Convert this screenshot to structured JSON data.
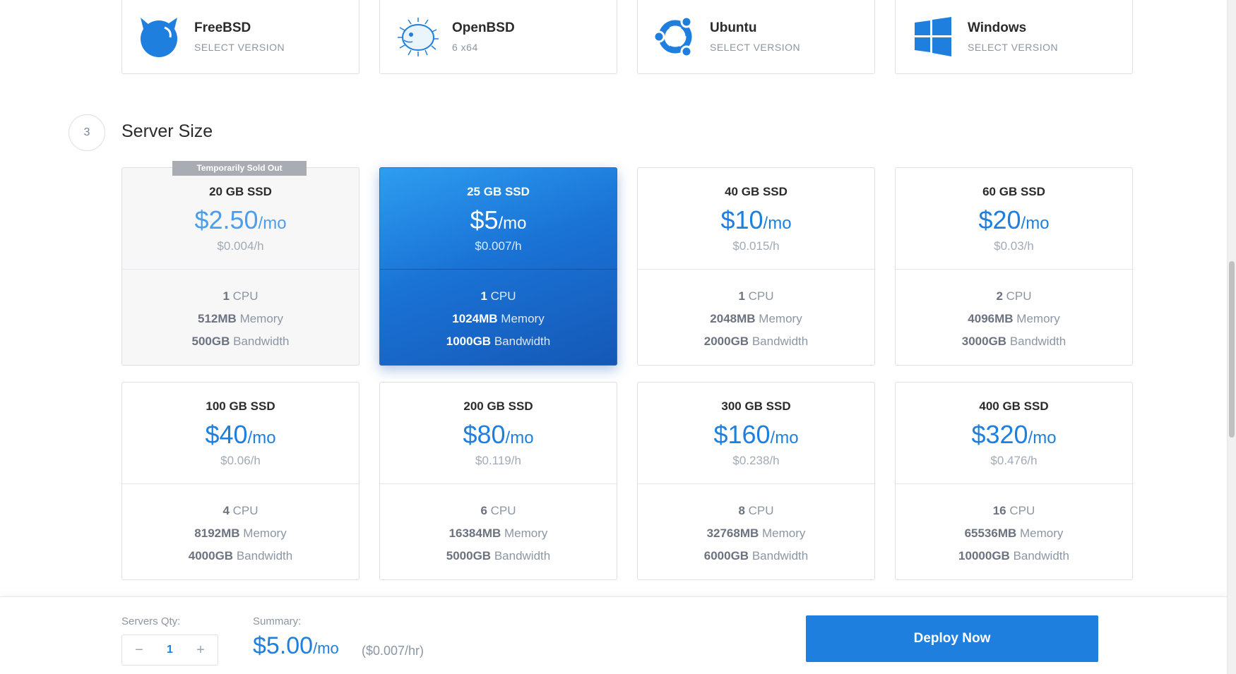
{
  "os_options": [
    {
      "name": "FreeBSD",
      "sub": "SELECT VERSION",
      "icon": "freebsd-icon"
    },
    {
      "name": "OpenBSD",
      "sub": "6  x64",
      "icon": "openbsd-icon"
    },
    {
      "name": "Ubuntu",
      "sub": "SELECT VERSION",
      "icon": "ubuntu-icon"
    },
    {
      "name": "Windows",
      "sub": "SELECT VERSION",
      "icon": "windows-icon"
    }
  ],
  "section": {
    "step": "3",
    "title": "Server Size"
  },
  "plans": [
    {
      "ssd": "20 GB SSD",
      "price": "$2.50",
      "unit": "/mo",
      "hourly": "$0.004/h",
      "cpu": "1",
      "cpu_label": "CPU",
      "memory": "512MB",
      "memory_label": "Memory",
      "bandwidth": "500GB",
      "bandwidth_label": "Bandwidth",
      "badge": "Temporarily Sold Out"
    },
    {
      "ssd": "25 GB SSD",
      "price": "$5",
      "unit": "/mo",
      "hourly": "$0.007/h",
      "cpu": "1",
      "cpu_label": "CPU",
      "memory": "1024MB",
      "memory_label": "Memory",
      "bandwidth": "1000GB",
      "bandwidth_label": "Bandwidth"
    },
    {
      "ssd": "40 GB SSD",
      "price": "$10",
      "unit": "/mo",
      "hourly": "$0.015/h",
      "cpu": "1",
      "cpu_label": "CPU",
      "memory": "2048MB",
      "memory_label": "Memory",
      "bandwidth": "2000GB",
      "bandwidth_label": "Bandwidth"
    },
    {
      "ssd": "60 GB SSD",
      "price": "$20",
      "unit": "/mo",
      "hourly": "$0.03/h",
      "cpu": "2",
      "cpu_label": "CPU",
      "memory": "4096MB",
      "memory_label": "Memory",
      "bandwidth": "3000GB",
      "bandwidth_label": "Bandwidth"
    },
    {
      "ssd": "100 GB SSD",
      "price": "$40",
      "unit": "/mo",
      "hourly": "$0.06/h",
      "cpu": "4",
      "cpu_label": "CPU",
      "memory": "8192MB",
      "memory_label": "Memory",
      "bandwidth": "4000GB",
      "bandwidth_label": "Bandwidth"
    },
    {
      "ssd": "200 GB SSD",
      "price": "$80",
      "unit": "/mo",
      "hourly": "$0.119/h",
      "cpu": "6",
      "cpu_label": "CPU",
      "memory": "16384MB",
      "memory_label": "Memory",
      "bandwidth": "5000GB",
      "bandwidth_label": "Bandwidth"
    },
    {
      "ssd": "300 GB SSD",
      "price": "$160",
      "unit": "/mo",
      "hourly": "$0.238/h",
      "cpu": "8",
      "cpu_label": "CPU",
      "memory": "32768MB",
      "memory_label": "Memory",
      "bandwidth": "6000GB",
      "bandwidth_label": "Bandwidth"
    },
    {
      "ssd": "400 GB SSD",
      "price": "$320",
      "unit": "/mo",
      "hourly": "$0.476/h",
      "cpu": "16",
      "cpu_label": "CPU",
      "memory": "65536MB",
      "memory_label": "Memory",
      "bandwidth": "10000GB",
      "bandwidth_label": "Bandwidth"
    }
  ],
  "selected_plan": "25 GB SSD",
  "bottom_bar": {
    "qty_label": "Servers Qty:",
    "qty_minus": "−",
    "qty_value": "1",
    "qty_plus": "+",
    "summary_label": "Summary:",
    "summary_price": "$5.00",
    "summary_unit": "/mo",
    "summary_hourly": "($0.007/hr)",
    "deploy_label": "Deploy Now"
  },
  "colors": {
    "accent": "#1e7fde",
    "selected_gradient_start": "#2e9df0",
    "selected_gradient_end": "#1558b6",
    "badge": "#a9acb2"
  }
}
